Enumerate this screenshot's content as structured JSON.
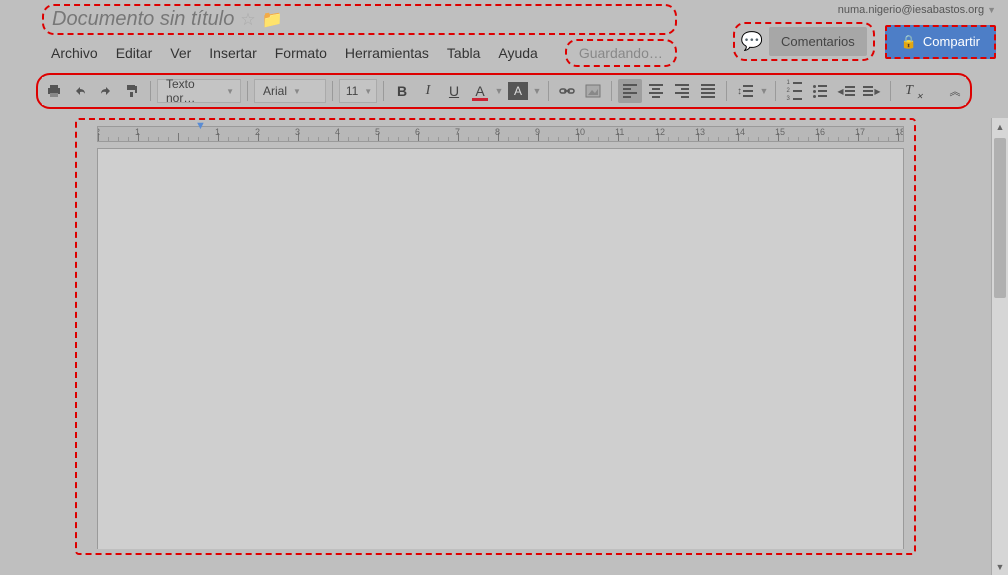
{
  "header": {
    "title": "Documento sin título",
    "user_email": "numa.nigerio@iesabastos.org",
    "save_status": "Guardando…",
    "comments_label": "Comentarios",
    "share_label": "Compartir"
  },
  "menu": {
    "items": [
      "Archivo",
      "Editar",
      "Ver",
      "Insertar",
      "Formato",
      "Herramientas",
      "Tabla",
      "Ayuda"
    ]
  },
  "toolbar": {
    "styles": "Texto nor…",
    "font": "Arial",
    "size": "11",
    "text_color": "#c02335",
    "icons": {
      "print": "print-icon",
      "undo": "undo-icon",
      "redo": "redo-icon",
      "paint": "paint-format-icon",
      "bold": "B",
      "italic": "I",
      "underline": "U",
      "textcolor": "A",
      "highlight": "A",
      "link": "link-icon",
      "image": "image-icon",
      "align_left": "align-left-icon",
      "align_center": "align-center-icon",
      "align_right": "align-right-icon",
      "align_justify": "align-justify-icon",
      "line_spacing": "line-spacing-icon",
      "list_num": "numbered-list-icon",
      "list_bul": "bulleted-list-icon",
      "indent_dec": "decrease-indent-icon",
      "indent_inc": "increase-indent-icon",
      "clear_fmt": "clear-format-icon",
      "collapse": "collapse-icon"
    }
  },
  "ruler": {
    "labels": [
      "2",
      "1",
      "",
      "1",
      "2",
      "3",
      "4",
      "5",
      "6",
      "7",
      "8",
      "9",
      "10",
      "11",
      "12",
      "13",
      "14",
      "15",
      "16",
      "17",
      "18"
    ]
  }
}
